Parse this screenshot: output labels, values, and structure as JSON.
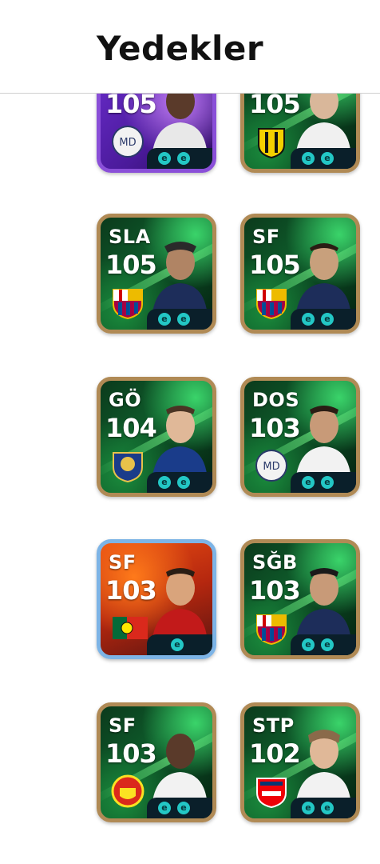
{
  "header": {
    "title": "Yedekler"
  },
  "cards": [
    {
      "position": "",
      "rating": "105",
      "crest": "crest-white-icon",
      "style": "purple",
      "boosts": 2
    },
    {
      "position": "",
      "rating": "105",
      "crest": "crest-yellow-black-icon",
      "style": "green",
      "boosts": 2
    },
    {
      "position": "SLA",
      "rating": "105",
      "crest": "crest-barcelona-icon",
      "style": "green",
      "boosts": 2
    },
    {
      "position": "SF",
      "rating": "105",
      "crest": "crest-barcelona-icon",
      "style": "green",
      "boosts": 2
    },
    {
      "position": "GÖ",
      "rating": "104",
      "crest": "crest-blue-gold-icon",
      "style": "green",
      "boosts": 2
    },
    {
      "position": "DOS",
      "rating": "103",
      "crest": "crest-white-icon",
      "style": "green",
      "boosts": 2
    },
    {
      "position": "SF",
      "rating": "103",
      "crest": "flag-portugal-icon",
      "style": "epic",
      "boosts": 1
    },
    {
      "position": "SĞB",
      "rating": "103",
      "crest": "crest-barcelona-icon",
      "style": "green",
      "boosts": 2
    },
    {
      "position": "SF",
      "rating": "103",
      "crest": "crest-manchester-united-icon",
      "style": "green",
      "boosts": 2
    },
    {
      "position": "STP",
      "rating": "102",
      "crest": "crest-arsenal-icon",
      "style": "green",
      "boosts": 2
    }
  ],
  "boost_glyph": "e"
}
